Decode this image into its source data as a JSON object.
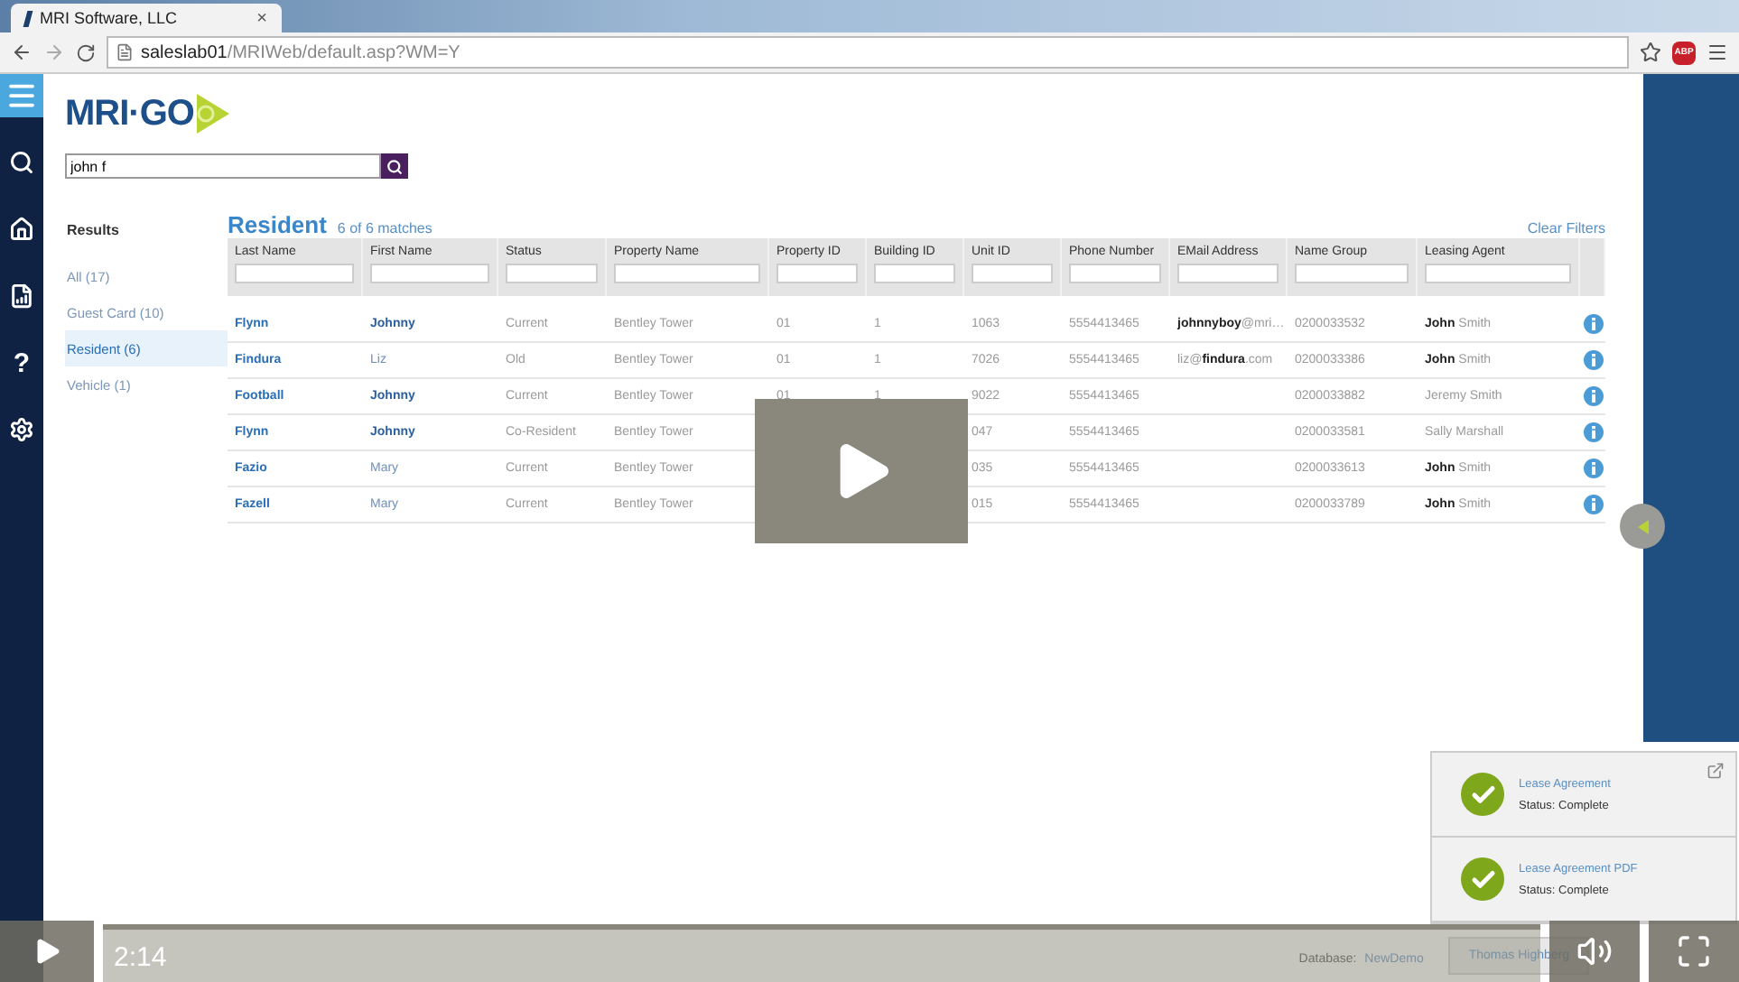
{
  "browser": {
    "tab": {
      "title": "MRI Software, LLC",
      "close": "×"
    },
    "url": "**saleslab01**/MRIWeb/default.asp?WM=Y",
    "adblock": "ABP"
  },
  "nav": {
    "items": [
      {
        "kind": "menu",
        "selected": true
      },
      {
        "kind": "search",
        "selected": false
      },
      {
        "kind": "home",
        "selected": false
      },
      {
        "kind": "report",
        "selected": false
      },
      {
        "kind": "help",
        "glyph": "?",
        "selected": false
      },
      {
        "kind": "settings",
        "selected": false
      }
    ]
  },
  "logo": "MRI·GO",
  "search": {
    "value": "john f"
  },
  "results": {
    "title": "Results",
    "items": [
      {
        "label": "All (17)",
        "selected": false
      },
      {
        "label": "Guest Card (10)",
        "selected": false
      },
      {
        "label": "Resident (6)",
        "selected": true
      },
      {
        "label": "Vehicle (1)",
        "selected": false
      }
    ]
  },
  "table": {
    "title": "Resident",
    "count": "6 of 6 matches",
    "clear": "Clear Filters",
    "columns": [
      "Last Name",
      "First Name",
      "Status",
      "Property Name",
      "Property ID",
      "Building ID",
      "Unit ID",
      "Phone Number",
      "EMail Address",
      "Name Group",
      "Leasing Agent"
    ],
    "rows": [
      {
        "cells": [
          "Flynn",
          "Johnny",
          "Current",
          "Bentley Tower",
          "01",
          "1",
          "1063",
          "5554413465",
          "**johnnyboy**@mri…",
          "0200033532",
          "**John** Smith"
        ],
        "first_match": true
      },
      {
        "cells": [
          "Findura",
          "Liz",
          "Old",
          "Bentley Tower",
          "01",
          "1",
          "7026",
          "5554413465",
          "liz@**findura**.com",
          "0200033386",
          "**John** Smith"
        ],
        "first_match": false
      },
      {
        "cells": [
          "Football",
          "Johnny",
          "Current",
          "Bentley Tower",
          "01",
          "1",
          "9022",
          "5554413465",
          null,
          "0200033882",
          "Jeremy Smith"
        ],
        "first_match": true
      },
      {
        "cells": [
          "Flynn",
          "Johnny",
          "Co-Resident",
          "Bentley Tower",
          null,
          null,
          "047",
          "5554413465",
          null,
          "0200033581",
          "Sally Marshall"
        ],
        "first_match": true
      },
      {
        "cells": [
          "Fazio",
          "Mary",
          "Current",
          "Bentley Tower",
          null,
          null,
          "035",
          "5554413465",
          null,
          "0200033613",
          "**John** Smith"
        ],
        "first_match": false
      },
      {
        "cells": [
          "Fazell",
          "Mary",
          "Current",
          "Bentley Tower",
          null,
          null,
          "015",
          "5554413465",
          null,
          "0200033789",
          "**John** Smith"
        ],
        "first_match": false
      }
    ]
  },
  "footer": {
    "db_label": "Database:",
    "db_value": "NewDemo",
    "user": "Thomas Highberg"
  },
  "notifications": [
    {
      "title": "Lease Agreement",
      "status": "Status: Complete"
    },
    {
      "title": "Lease Agreement PDF",
      "status": "Status: Complete"
    }
  ],
  "player": {
    "time": "2:14"
  }
}
